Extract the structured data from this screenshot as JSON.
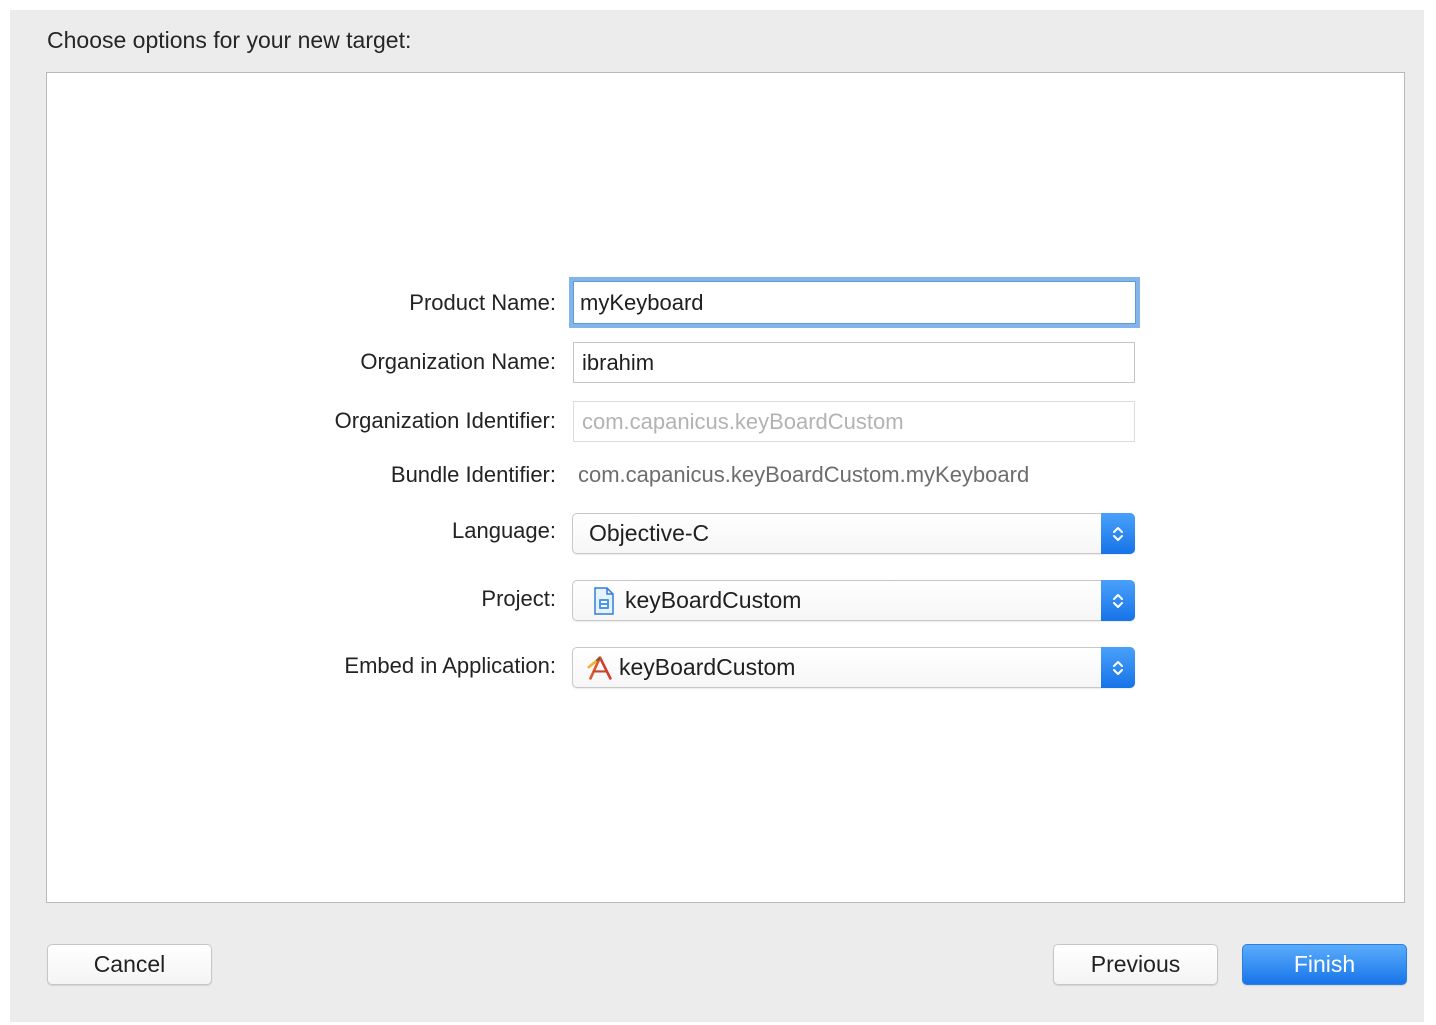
{
  "dialog": {
    "heading": "Choose options for your new target:"
  },
  "form": {
    "product_name": {
      "label": "Product Name:",
      "value": "myKeyboard"
    },
    "organization_name": {
      "label": "Organization Name:",
      "value": "ibrahim"
    },
    "organization_identifier": {
      "label": "Organization Identifier:",
      "value": "com.capanicus.keyBoardCustom"
    },
    "bundle_identifier": {
      "label": "Bundle Identifier:",
      "value": "com.capanicus.keyBoardCustom.myKeyboard"
    },
    "language": {
      "label": "Language:",
      "value": "Objective-C"
    },
    "project": {
      "label": "Project:",
      "value": "keyBoardCustom",
      "icon": "project-file-icon"
    },
    "embed_in_application": {
      "label": "Embed in Application:",
      "value": "keyBoardCustom",
      "icon": "xcode-app-icon"
    }
  },
  "buttons": {
    "cancel": "Cancel",
    "previous": "Previous",
    "finish": "Finish"
  },
  "colors": {
    "accent": "#1b7bef",
    "focus_ring": "#83b5ea"
  }
}
